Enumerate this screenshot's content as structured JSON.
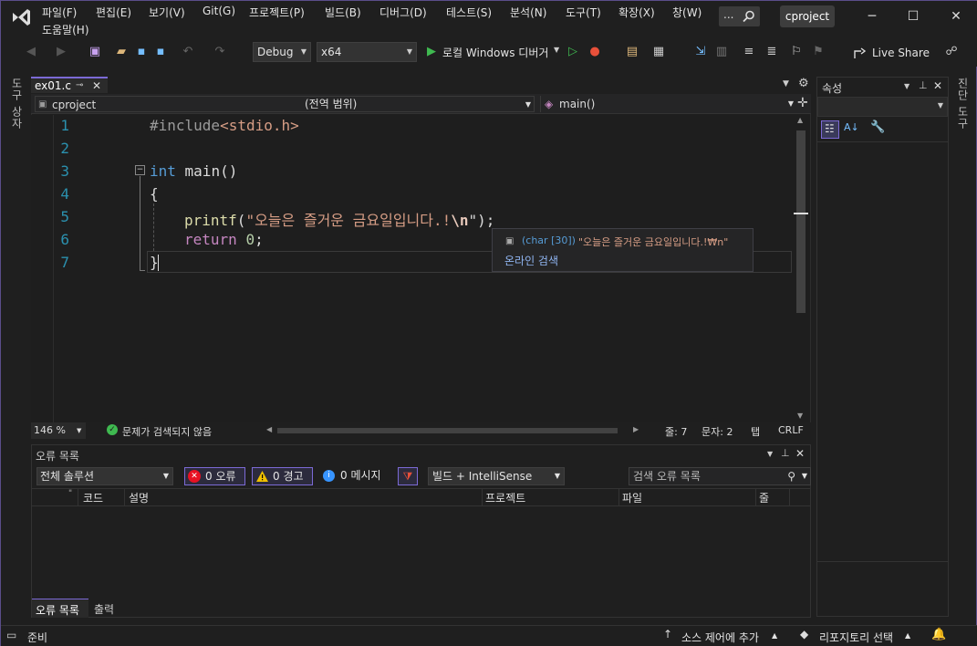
{
  "menu": {
    "items": [
      "파일(F)",
      "편집(E)",
      "보기(V)",
      "Git(G)",
      "프로젝트(P)",
      "빌드(B)",
      "디버그(D)",
      "테스트(S)",
      "분석(N)",
      "도구(T)",
      "확장(X)",
      "창(W)",
      "도움말(H)"
    ],
    "search_label": "...",
    "project_name": "cproject"
  },
  "toolbar": {
    "config": "Debug",
    "platform": "x64",
    "run_label": "로컬 Windows 디버거",
    "live_share": "Live Share"
  },
  "side_left": "도구 상자",
  "side_right": "진단 도구",
  "editor": {
    "tab_name": "ex01.c",
    "nav_project": "cproject",
    "nav_scope": "(전역 범위)",
    "nav_func": "main()",
    "line_numbers": [
      "1",
      "2",
      "3",
      "4",
      "5",
      "6",
      "7"
    ],
    "code": {
      "l1_pp": "#include",
      "l1_file": "<stdio.h>",
      "l3_kw": "int",
      "l3_rest": " main()",
      "l4": "{",
      "l5_fn": "printf",
      "l5_open": "(",
      "l5_str": "\"오늘은 즐거운 금요일입니다.!",
      "l5_esc": "\\n",
      "l5_close": "\");",
      "l6_kw": "return",
      "l6_num": "0",
      "l6_semi": ";",
      "l7": "}"
    },
    "tooltip_type": "(char [30])",
    "tooltip_value": "\"오늘은 즐거운 금요일입니다.!₩n\"",
    "tooltip_link": "온라인 검색",
    "zoom": "146 %",
    "status_ok": "문제가 검색되지 않음",
    "line_pos": "줄: 7",
    "char_pos": "문자: 2",
    "tab_mode": "탭",
    "eol": "CRLF"
  },
  "properties": {
    "title": "속성"
  },
  "error_list": {
    "title": "오류 목록",
    "scope": "전체 솔루션",
    "errors": "0 오류",
    "warnings": "0 경고",
    "messages": "0 메시지",
    "source": "빌드 + IntelliSense",
    "search_placeholder": "검색 오류 목록",
    "columns": [
      "코드",
      "설명",
      "프로젝트",
      "파일",
      "줄"
    ],
    "tabs": [
      "오류 목록",
      "출력"
    ]
  },
  "statusbar": {
    "ready": "준비",
    "source_control": "소스 제어에 추가",
    "repo": "리포지토리 선택"
  },
  "colors": {
    "accent": "#7c6ad6",
    "ok": "#3fb950",
    "error": "#e81123",
    "warning": "#f0c000"
  }
}
